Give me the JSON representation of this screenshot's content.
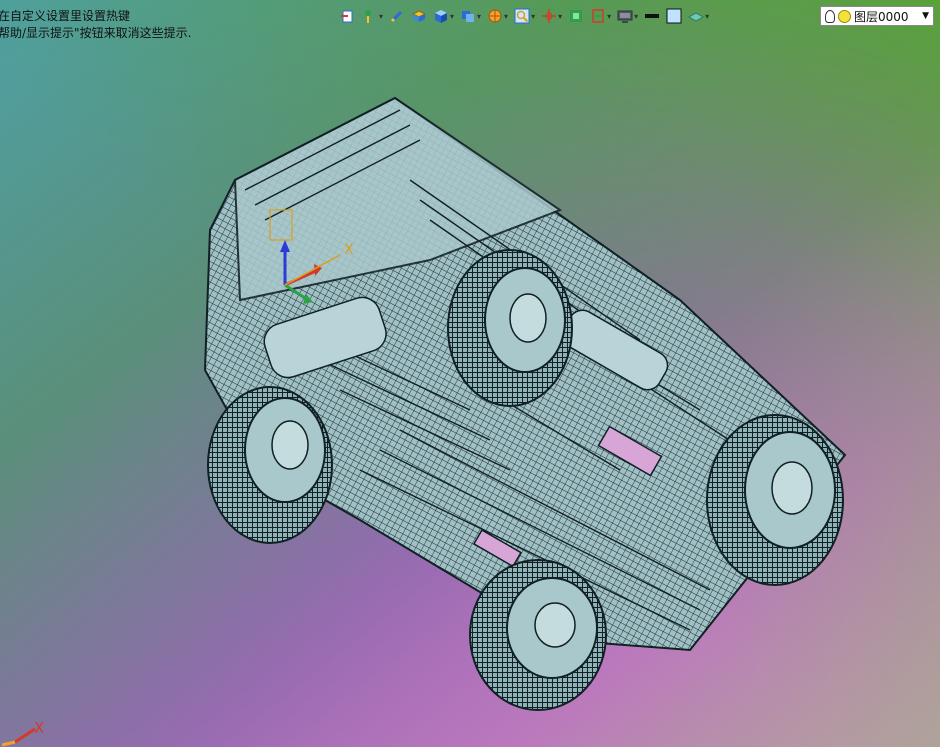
{
  "hints": {
    "line1": "在自定义设置里设置热键",
    "line2": "帮助/显示提示\"按钮来取消这些提示."
  },
  "toolbar": {
    "icons": [
      {
        "name": "exit-sketch-icon",
        "dropdown": false
      },
      {
        "name": "smart-dimension-icon",
        "dropdown": true
      },
      {
        "name": "edit-component-icon",
        "dropdown": false
      },
      {
        "name": "extrude-icon",
        "dropdown": false
      },
      {
        "name": "view-orientation-icon",
        "dropdown": true
      },
      {
        "name": "display-style-icon",
        "dropdown": true
      },
      {
        "name": "hide-show-items-icon",
        "dropdown": true
      },
      {
        "name": "zoom-icon",
        "dropdown": true
      },
      {
        "name": "reference-geometry-icon",
        "dropdown": true
      },
      {
        "name": "section-view-icon",
        "dropdown": false
      },
      {
        "name": "view-settings-icon",
        "dropdown": true
      },
      {
        "name": "monitor-icon",
        "dropdown": true
      },
      {
        "name": "line-style-icon",
        "dropdown": false
      },
      {
        "name": "color-icon",
        "dropdown": false
      },
      {
        "name": "appearance-icon",
        "dropdown": true
      }
    ],
    "layer_label": "图层0000",
    "colors": {
      "blue": "#2d6ad8",
      "yellow": "#f2c230",
      "green": "#2da04a",
      "red": "#d23a2a"
    }
  },
  "axis_label": "X"
}
